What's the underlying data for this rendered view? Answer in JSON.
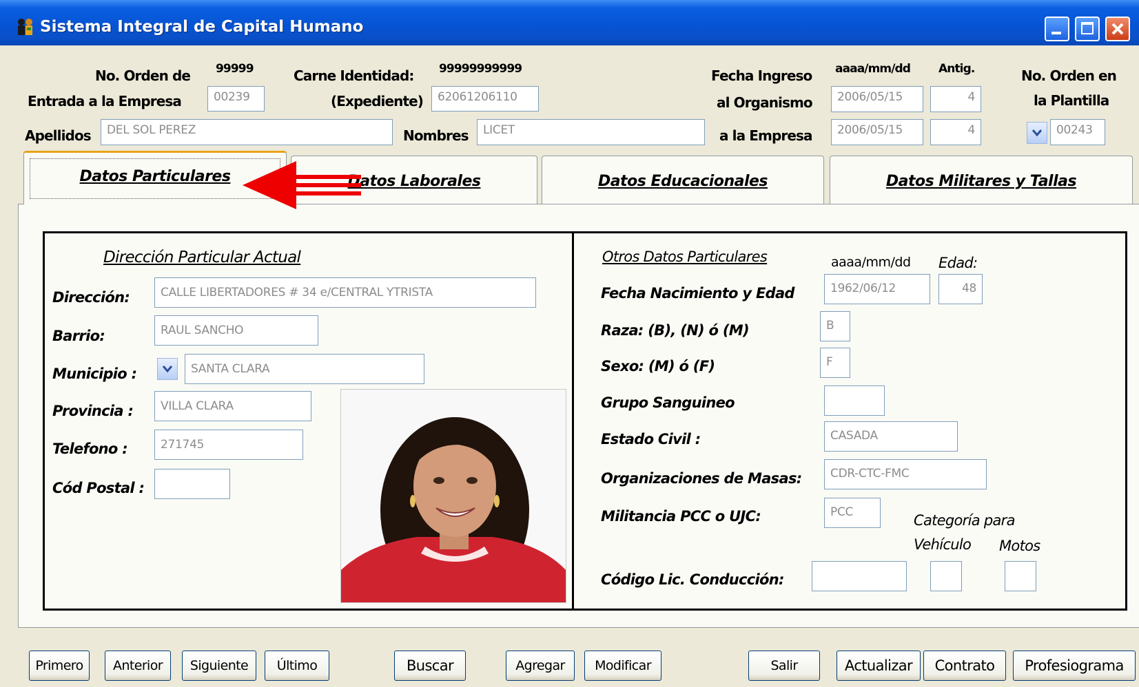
{
  "window": {
    "title": "Sistema Integral de Capital Humano"
  },
  "header": {
    "orden_label_1": "No. Orden de",
    "orden_label_2": "Entrada a la Empresa",
    "orden_hint": "99999",
    "orden_value": "00239",
    "carne_label_1": "Carne Identidad:",
    "carne_label_2": "(Expediente)",
    "carne_hint": "99999999999",
    "carne_value": "62061206110",
    "apellidos_label": "Apellidos",
    "apellidos_value": "DEL SOL PEREZ",
    "nombres_label": "Nombres",
    "nombres_value": "LICET",
    "fecha_label_1": "Fecha Ingreso",
    "fecha_label_2": "al Organismo",
    "fecha_label_3": "a la Empresa",
    "fecha_hint": "aaaa/mm/dd",
    "antig_label": "Antig.",
    "fecha_organismo": "2006/05/15",
    "antig_organismo": "4",
    "fecha_empresa": "2006/05/15",
    "antig_empresa": "4",
    "plantilla_label_1": "No. Orden en",
    "plantilla_label_2": "la Plantilla",
    "plantilla_value": "00243"
  },
  "tabs": [
    {
      "label": "Datos Particulares",
      "active": true
    },
    {
      "label": "Datos Laborales",
      "active": false
    },
    {
      "label": "Datos Educacionales",
      "active": false
    },
    {
      "label": "Datos Militares y Tallas",
      "active": false
    }
  ],
  "left": {
    "section_title": "Dirección Particular Actual",
    "direccion_label": "Dirección:",
    "direccion_value": "CALLE LIBERTADORES # 34 e/CENTRAL YTRISTA",
    "barrio_label": "Barrio:",
    "barrio_value": "RAUL SANCHO",
    "municipio_label": "Municipio :",
    "municipio_value": "SANTA CLARA",
    "provincia_label": "Provincia :",
    "provincia_value": "VILLA CLARA",
    "telefono_label": "Telefono :",
    "telefono_value": "271745",
    "postal_label": "Cód Postal :",
    "postal_value": ""
  },
  "right": {
    "section_title": "Otros Datos Particulares",
    "fecha_hint": "aaaa/mm/dd",
    "edad_label": "Edad:",
    "nacimiento_label": "Fecha Nacimiento y Edad",
    "nacimiento_value": "1962/06/12",
    "edad_value": "48",
    "raza_label": "Raza: (B), (N) ó (M)",
    "raza_value": "B",
    "sexo_label": "Sexo: (M) ó (F)",
    "sexo_value": "F",
    "grupo_label": "Grupo Sanguineo",
    "grupo_value": "",
    "civil_label": "Estado Civil :",
    "civil_value": "CASADA",
    "masas_label": "Organizaciones de Masas:",
    "masas_value": "CDR-CTC-FMC",
    "militancia_label": "Militancia PCC o UJC:",
    "militancia_value": "PCC",
    "categoria_label": "Categoría para",
    "vehiculo_label": "Vehículo",
    "motos_label": "Motos",
    "licencia_label": "Código Lic. Conducción:",
    "licencia_value": "",
    "vehiculo_value": "",
    "motos_value": ""
  },
  "buttons": {
    "primero": "Primero",
    "anterior": "Anterior",
    "siguiente": "Siguiente",
    "ultimo": "Último",
    "buscar": "Buscar",
    "agregar": "Agregar",
    "modificar": "Modificar",
    "salir": "Salir",
    "actualizar": "Actualizar",
    "contrato": "Contrato",
    "profesiograma": "Profesiograma"
  },
  "icons": {
    "app": "people-icon",
    "dropdown": "chevron-down-icon",
    "annotation": "red-arrow-icon"
  },
  "colors": {
    "titlebar": "#0654d4",
    "active_tab_accent": "#e8a318",
    "arrow": "#ee0000",
    "field_text": "#8c8c8c"
  }
}
